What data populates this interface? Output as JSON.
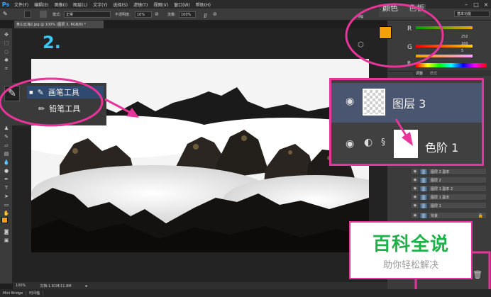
{
  "app": {
    "logo": "Ps"
  },
  "menu": [
    "文件(F)",
    "编辑(E)",
    "图像(I)",
    "图层(L)",
    "文字(Y)",
    "选择(S)",
    "滤镜(T)",
    "视图(V)",
    "窗口(W)",
    "帮助(H)"
  ],
  "options": {
    "mode_label": "模式:",
    "mode_value": "正常",
    "opacity_label": "不透明度:",
    "opacity_value": "10%",
    "flow_label": "流量:",
    "flow_value": "100%"
  },
  "workspace": "基本功能",
  "document": {
    "tab_title": "黄山云海2.jpg @ 100% (图层 3, RGB/8) *",
    "zoom": "100%",
    "doc_info": "文档:1.61M/11.8M"
  },
  "annotation": {
    "step": "2."
  },
  "brush_menu": {
    "items": [
      {
        "label": "画笔工具",
        "selected": true
      },
      {
        "label": "铅笔工具",
        "selected": false
      }
    ]
  },
  "color_panel": {
    "tabs": [
      "颜色",
      "色板"
    ],
    "channels": [
      {
        "label": "R",
        "value": "252"
      },
      {
        "label": "G",
        "value": "160"
      },
      {
        "label": "B",
        "value": "5"
      }
    ],
    "foreground": "#f5a00a",
    "background": "#ffffff"
  },
  "layers_panel_small": {
    "tabs": [
      "调整",
      "样式"
    ],
    "rows": [
      "图层 2 副本",
      "图层 2",
      "图层 1 副本 2",
      "图层 1 副本",
      "图层 1",
      "背景"
    ]
  },
  "layers_zoom": {
    "rows": [
      {
        "name": "图层 3"
      },
      {
        "name": "色阶 1"
      }
    ]
  },
  "bottom_tabs": [
    "Mini Bridge",
    "时间轴"
  ],
  "watermark": {
    "title": "百科全说",
    "subtitle": "助你轻松解决"
  },
  "colors": {
    "accent_pink": "#e8359a",
    "step_blue": "#39c8f4",
    "brand_green": "#1fb24a"
  }
}
